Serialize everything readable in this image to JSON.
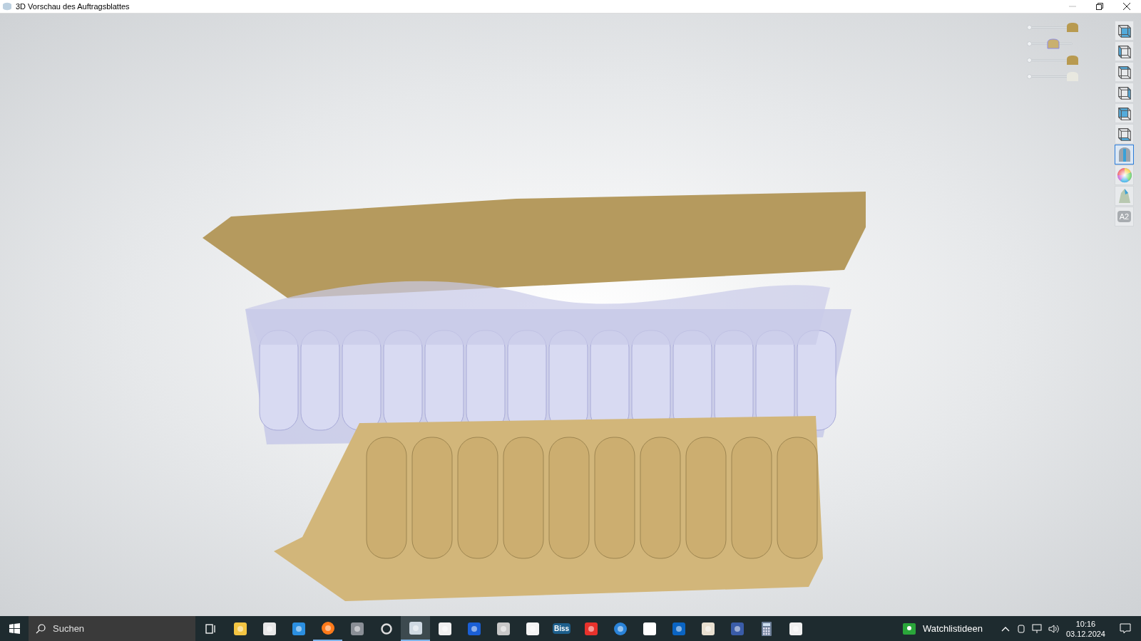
{
  "window": {
    "title": "3D Vorschau des Auftragsblattes"
  },
  "sliders": [
    {
      "kind": "crown",
      "level": 1.0
    },
    {
      "kind": "splint",
      "level": 0.5
    },
    {
      "kind": "split",
      "level": 1.0
    },
    {
      "kind": "white",
      "level": 1.0
    }
  ],
  "tools": [
    {
      "kind": "front",
      "selected": false
    },
    {
      "kind": "left",
      "selected": false
    },
    {
      "kind": "top",
      "selected": false
    },
    {
      "kind": "right",
      "selected": false
    },
    {
      "kind": "back",
      "selected": false
    },
    {
      "kind": "bottom",
      "selected": false
    },
    {
      "kind": "tooth",
      "selected": true
    },
    {
      "kind": "color",
      "selected": false
    },
    {
      "kind": "shade",
      "selected": false
    },
    {
      "kind": "label",
      "text": "A2",
      "selected": false
    }
  ],
  "taskbar": {
    "search_placeholder": "Suchen",
    "apps": [
      {
        "kind": "taskview",
        "running": false,
        "selected": false
      },
      {
        "kind": "folder",
        "running": false,
        "selected": false
      },
      {
        "kind": "store",
        "running": false,
        "selected": false
      },
      {
        "kind": "mail",
        "running": false,
        "selected": false
      },
      {
        "kind": "browser",
        "running": true,
        "selected": false
      },
      {
        "kind": "camera",
        "running": false,
        "selected": false
      },
      {
        "kind": "ring",
        "running": false,
        "selected": false
      },
      {
        "kind": "viewer",
        "running": true,
        "selected": true
      },
      {
        "kind": "shield",
        "running": false,
        "selected": false
      },
      {
        "kind": "remote",
        "running": false,
        "selected": false
      },
      {
        "kind": "tooth",
        "running": false,
        "selected": false
      },
      {
        "kind": "pdf",
        "running": false,
        "selected": false
      },
      {
        "kind": "text",
        "text": "Biss",
        "running": false,
        "selected": false
      },
      {
        "kind": "share",
        "running": false,
        "selected": false
      },
      {
        "kind": "wave",
        "running": false,
        "selected": false
      },
      {
        "kind": "cross",
        "running": false,
        "selected": false
      },
      {
        "kind": "outlook",
        "running": false,
        "selected": false
      },
      {
        "kind": "printer",
        "running": false,
        "selected": false
      },
      {
        "kind": "picture",
        "running": false,
        "selected": false
      },
      {
        "kind": "calculator",
        "running": false,
        "selected": false
      },
      {
        "kind": "shield",
        "running": false,
        "selected": false
      }
    ],
    "widget": "Watchlistideen",
    "time": "10:16",
    "date": "03.12.2024"
  }
}
